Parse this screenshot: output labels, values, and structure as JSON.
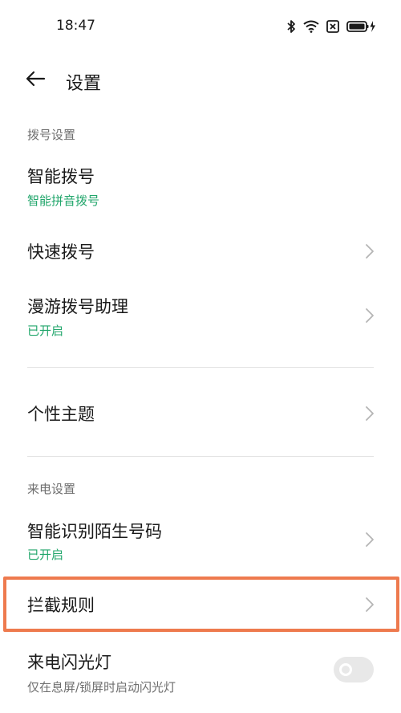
{
  "status_bar": {
    "time": "18:47",
    "icons": [
      "bluetooth-icon",
      "wifi-icon",
      "no-sim-icon",
      "battery-charging-icon"
    ]
  },
  "header": {
    "back_icon": "arrow-left-icon",
    "title": "设置"
  },
  "sections": {
    "dial": {
      "title": "拨号设置",
      "items": [
        {
          "label": "智能拨号",
          "subtitle": "智能拼音拨号"
        },
        {
          "label": "快速拨号"
        },
        {
          "label": "漫游拨号助理",
          "subtitle": "已开启"
        }
      ]
    },
    "theme": {
      "items": [
        {
          "label": "个性主题"
        }
      ]
    },
    "incoming": {
      "title": "来电设置",
      "items": [
        {
          "label": "智能识别陌生号码",
          "subtitle": "已开启"
        },
        {
          "label": "拦截规则"
        },
        {
          "label": "来电闪光灯",
          "subtitle": "仅在息屏/锁屏时启动闪光灯",
          "toggle": false
        }
      ]
    }
  },
  "colors": {
    "accent_green": "#21a66b",
    "highlight_orange": "#ee7a4e",
    "secondary_text": "#6f6f6f"
  }
}
